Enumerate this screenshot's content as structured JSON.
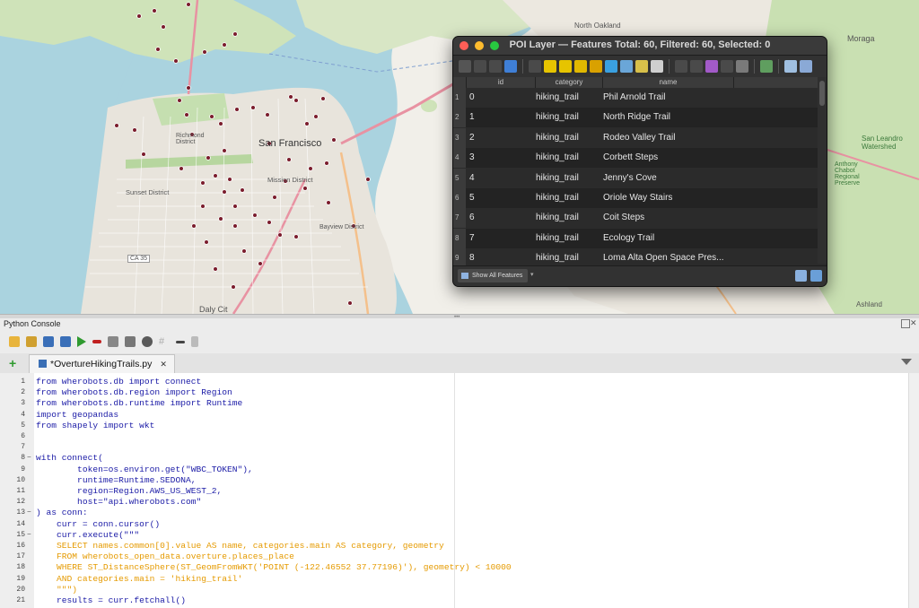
{
  "map": {
    "labels": [
      {
        "id": "sf",
        "text": "San Francisco"
      },
      {
        "id": "richmond",
        "text": "Richmond District"
      },
      {
        "id": "sunset",
        "text": "Sunset District"
      },
      {
        "id": "mission",
        "text": "Mission District"
      },
      {
        "id": "bayview",
        "text": "Bayview District"
      },
      {
        "id": "daly",
        "text": "Daly Cit"
      },
      {
        "id": "oakland",
        "text": "North Oakland"
      },
      {
        "id": "moraga",
        "text": "Moraga"
      },
      {
        "id": "sanleandro",
        "text": "San Leandro Watershed"
      },
      {
        "id": "anthony",
        "text": "Anthony Chabot Regional Preserve"
      },
      {
        "id": "ashland",
        "text": "Ashland"
      },
      {
        "id": "ca35",
        "text": "CA 35"
      }
    ]
  },
  "attribute_table": {
    "title": "POI Layer — Features Total: 60, Filtered: 60, Selected: 0",
    "columns": [
      "id",
      "category",
      "name"
    ],
    "rows": [
      {
        "row_num": "1",
        "id": "0",
        "category": "hiking_trail",
        "name": "Phil Arnold Trail"
      },
      {
        "row_num": "2",
        "id": "1",
        "category": "hiking_trail",
        "name": "North Ridge Trail"
      },
      {
        "row_num": "3",
        "id": "2",
        "category": "hiking_trail",
        "name": "Rodeo Valley Trail"
      },
      {
        "row_num": "4",
        "id": "3",
        "category": "hiking_trail",
        "name": "Corbett Steps"
      },
      {
        "row_num": "5",
        "id": "4",
        "category": "hiking_trail",
        "name": "Jenny's Cove"
      },
      {
        "row_num": "6",
        "id": "5",
        "category": "hiking_trail",
        "name": "Oriole Way Stairs"
      },
      {
        "row_num": "7",
        "id": "6",
        "category": "hiking_trail",
        "name": "Coit Steps"
      },
      {
        "row_num": "8",
        "id": "7",
        "category": "hiking_trail",
        "name": "Ecology Trail"
      },
      {
        "row_num": "9",
        "id": "8",
        "category": "hiking_trail",
        "name": "Loma Alta Open Space Pres..."
      }
    ],
    "filter_button": "Show All Features",
    "colors": {
      "title_bar": "#3a3a3a",
      "row_even": "#2b2b2b",
      "row_odd": "#232323"
    }
  },
  "console": {
    "title": "Python Console",
    "tab_label": "*OvertureHikingTrails.py",
    "add_tab_label": "+",
    "code": [
      {
        "ln": "1",
        "text": "from wherobots.db import connect"
      },
      {
        "ln": "2",
        "text": "from wherobots.db.region import Region"
      },
      {
        "ln": "3",
        "text": "from wherobots.db.runtime import Runtime"
      },
      {
        "ln": "4",
        "text": "import geopandas"
      },
      {
        "ln": "5",
        "text": "from shapely import wkt"
      },
      {
        "ln": "6",
        "text": ""
      },
      {
        "ln": "7",
        "text": ""
      },
      {
        "ln": "8",
        "text": "with connect("
      },
      {
        "ln": "9",
        "text": "        token=os.environ.get(\"WBC_TOKEN\"),"
      },
      {
        "ln": "10",
        "text": "        runtime=Runtime.SEDONA,"
      },
      {
        "ln": "11",
        "text": "        region=Region.AWS_US_WEST_2,"
      },
      {
        "ln": "12",
        "text": "        host=\"api.wherobots.com\""
      },
      {
        "ln": "13",
        "text": ") as conn:"
      },
      {
        "ln": "14",
        "text": "    curr = conn.cursor()"
      },
      {
        "ln": "15",
        "text": "    curr.execute(\"\"\""
      },
      {
        "ln": "16",
        "text": "    SELECT names.common[0].value AS name, categories.main AS category, geometry"
      },
      {
        "ln": "17",
        "text": "    FROM wherobots_open_data.overture.places_place"
      },
      {
        "ln": "18",
        "text": "    WHERE ST_DistanceSphere(ST_GeomFromWKT('POINT (-122.46552 37.77196)'), geometry) < 10000"
      },
      {
        "ln": "19",
        "text": "    AND categories.main = 'hiking_trail'"
      },
      {
        "ln": "20",
        "text": "    \"\"\")"
      },
      {
        "ln": "21",
        "text": "    results = curr.fetchall()"
      }
    ],
    "colors": {
      "keyword": "#1a1aa6",
      "string": "#e59a00",
      "plain": "#000000"
    }
  }
}
